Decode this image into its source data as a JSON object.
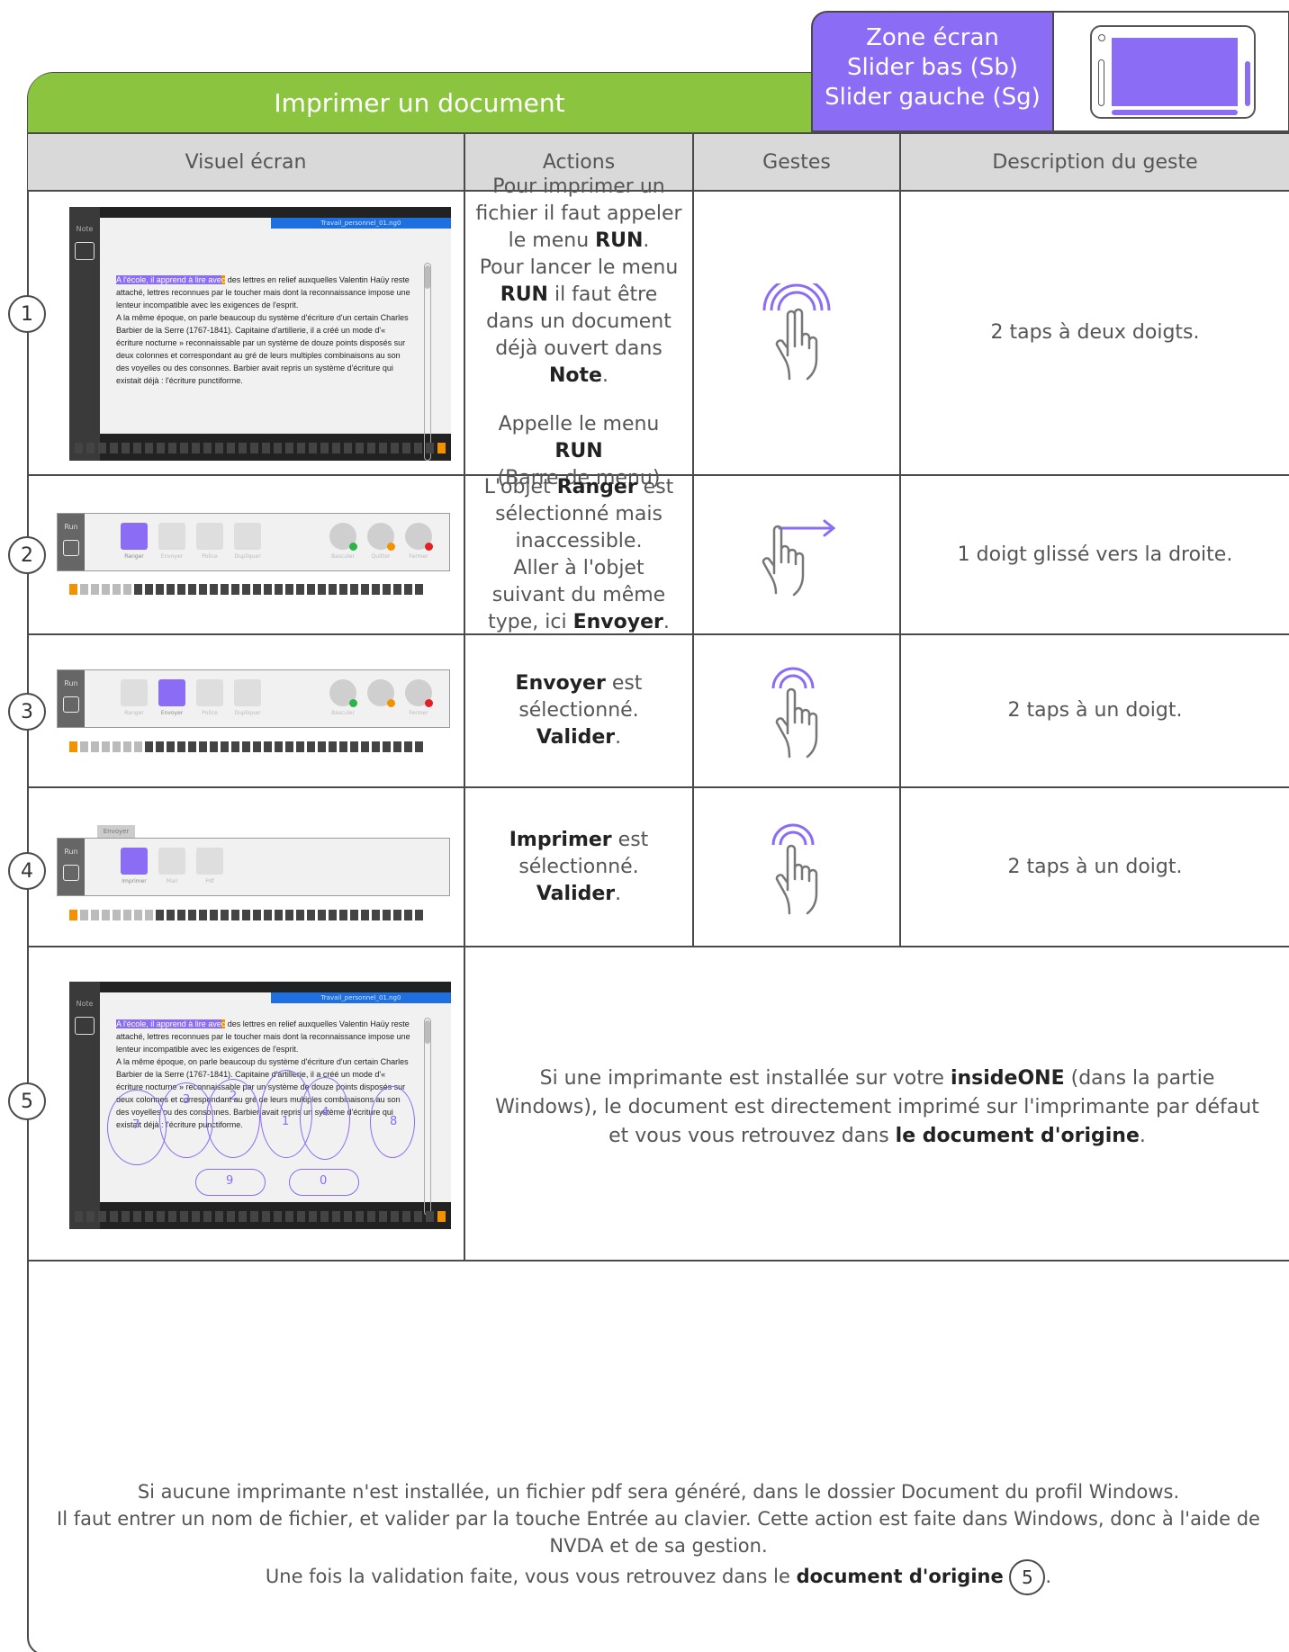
{
  "title": "Imprimer un document",
  "zone": {
    "line1": "Zone écran",
    "line2": "Slider bas (Sb)",
    "line3": "Slider gauche (Sg)"
  },
  "headers": {
    "visuel": "Visuel écran",
    "actions": "Actions",
    "gestes": "Gestes",
    "description": "Description du geste"
  },
  "colors": {
    "green": "#8bc53f",
    "purple": "#8a6cf5",
    "orange": "#f39200",
    "blue": "#1e6fe0"
  },
  "screens": {
    "note_label": "Note",
    "run_label": "Run",
    "file_tab": "Travail_personnel_01.ng0",
    "envoyer_tab": "Envoyer",
    "text_hl1": "A l'école, il apprend à lire ave",
    "text_hl2": "c",
    "text_rest": " des lettres en relief auxquelles Valentin Haüy reste attaché, lettres reconnues par le toucher mais dont la reconnaissance impose une lenteur incompatible avec les exigences de l'esprit.",
    "text_p2": "A la même époque, on parle beaucoup du système d'écriture d'un certain Charles Barbier de la Serre (1767-1841). Capitaine d'artillerie, il a créé un mode d'« écriture nocturne » reconnaissable par un système de douze points disposés sur deux colonnes et correspondant au gré de leurs multiples combinaisons au son des voyelles ou des consonnes. Barbier avait repris un système d'écriture qui existait déjà : l'écriture punctiforme.",
    "tiles_run": [
      "Ranger",
      "Envoyer",
      "Police",
      "Dupliquer"
    ],
    "circles_run": [
      "Basculer",
      "Quitter",
      "Fermer"
    ],
    "tiles_send": [
      "Imprimer",
      "Mail",
      "Pdf"
    ],
    "overlay_nums": [
      "7",
      "3",
      "2",
      "1",
      "4",
      "8",
      "9",
      "0"
    ]
  },
  "rows": [
    {
      "num": "1",
      "actions": {
        "a": "Pour imprimer un fichier il faut appeler le menu",
        "b": "RUN",
        "c": ".",
        "d": "Pour lancer le menu",
        "e": "RUN",
        "f": "il faut être dans un document déjà ouvert dans",
        "g": "Note",
        "h": ".",
        "i": "Appelle le menu",
        "j": "RUN",
        "k": "(Barre de menu)"
      },
      "gesture": "two-finger-double-tap-icon",
      "description": "2 taps à deux doigts."
    },
    {
      "num": "2",
      "actions": {
        "a": "L'objet",
        "b": "Ranger",
        "c": "est sélectionné mais inaccessible.",
        "d": "Aller à l'objet suivant du même type, ici",
        "e": "Envoyer",
        "f": "."
      },
      "gesture": "one-finger-swipe-right-icon",
      "description": "1 doigt glissé vers la droite."
    },
    {
      "num": "3",
      "actions": {
        "a": "Envoyer",
        "b": "est sélectionné.",
        "c": "Valider",
        "d": "."
      },
      "gesture": "one-finger-double-tap-icon",
      "description": "2 taps à un doigt."
    },
    {
      "num": "4",
      "actions": {
        "a": "Imprimer",
        "b": "est sélectionné.",
        "c": "Valider",
        "d": "."
      },
      "gesture": "one-finger-double-tap-icon",
      "description": "2 taps à un doigt."
    },
    {
      "num": "5",
      "text": {
        "a": "Si une imprimante est installée sur votre",
        "b": "insideONE",
        "c": "(dans la partie Windows), le document est directement imprimé sur l'imprimante par défaut et vous vous retrouvez dans",
        "d": "le document d'origine",
        "e": "."
      }
    }
  ],
  "bottom": {
    "line1": "Si aucune imprimante n'est installée, un fichier pdf sera généré, dans le dossier Document du profil Windows.",
    "line2": "Il faut entrer un nom de fichier, et valider par la touche Entrée au clavier. Cette action est faite dans Windows, donc à l'aide de NVDA et de sa gestion.",
    "line3a": "Une fois la validation faite, vous vous retrouvez dans le",
    "line3b": "document d'origine",
    "line3num": "5",
    "line3c": "."
  }
}
